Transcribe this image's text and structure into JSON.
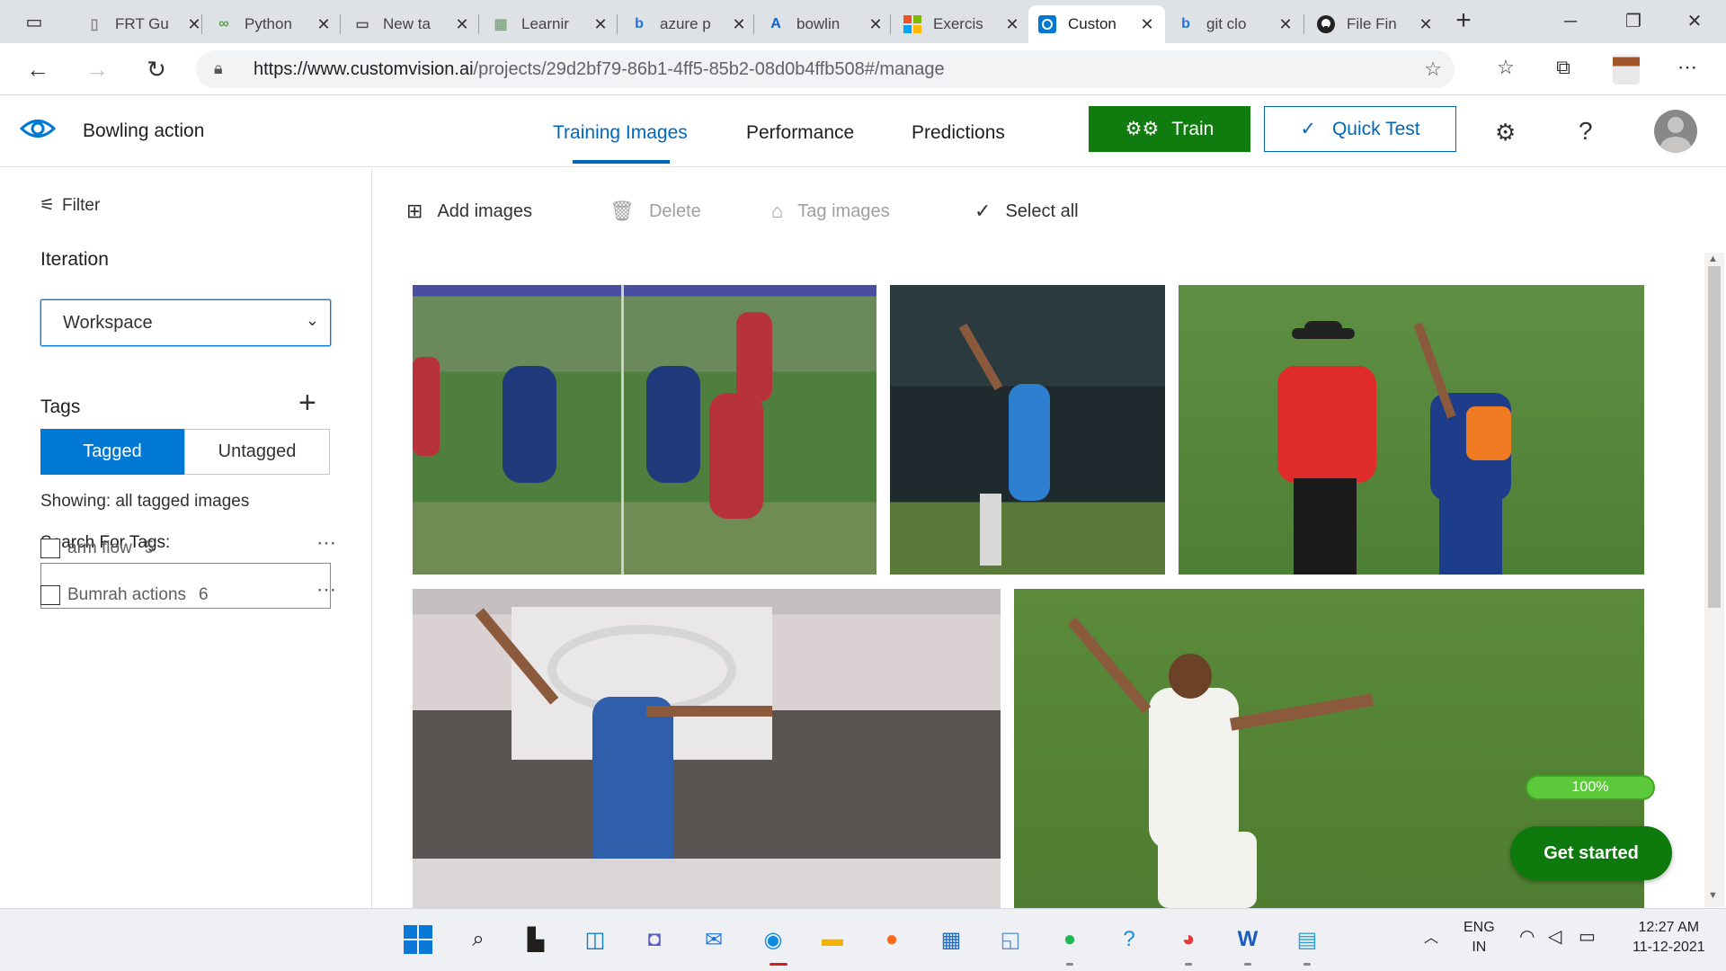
{
  "browser": {
    "tabs": [
      {
        "title": "FRT Gu",
        "icon": "document-icon"
      },
      {
        "title": "Python",
        "icon": "python-icon"
      },
      {
        "title": "New ta",
        "icon": "newtab-icon"
      },
      {
        "title": "Learnir",
        "icon": "learn-icon"
      },
      {
        "title": "azure p",
        "icon": "bing-icon"
      },
      {
        "title": "bowlin",
        "icon": "azure-icon"
      },
      {
        "title": "Exercis",
        "icon": "microsoft-icon"
      },
      {
        "title": "Custon",
        "icon": "customvision-icon",
        "active": true
      },
      {
        "title": "git clo",
        "icon": "bing-icon"
      },
      {
        "title": "File Fin",
        "icon": "github-icon"
      }
    ],
    "url_host": "https://www.customvision.ai",
    "url_path": "/projects/29d2bf79-86b1-4ff5-85b2-08d0b4ffb508#/manage"
  },
  "app": {
    "project_name": "Bowling action",
    "nav": {
      "training": "Training Images",
      "performance": "Performance",
      "predictions": "Predictions"
    },
    "train_label": "Train",
    "quick_test_label": "Quick Test",
    "help_label": "?"
  },
  "sidebar": {
    "filter_label": "Filter",
    "iteration_title": "Iteration",
    "iteration_value": "Workspace",
    "tags_title": "Tags",
    "tagged_label": "Tagged",
    "untagged_label": "Untagged",
    "showing_text": "Showing: all tagged images",
    "search_label": "Search For Tags:",
    "search_value": "",
    "tags": [
      {
        "name": "arm flow",
        "count": "5"
      },
      {
        "name": "Bumrah actions",
        "count": "6"
      }
    ]
  },
  "toolbar": {
    "add_images": "Add images",
    "delete": "Delete",
    "tag_images": "Tag images",
    "select_all": "Select all"
  },
  "progress_text": "100%",
  "progress_fraction": 1.0,
  "get_started": "Get started",
  "taskbar": {
    "lang_line1": "ENG",
    "lang_line2": "IN",
    "time": "12:27 AM",
    "date": "11-12-2021"
  },
  "colors": {
    "accent": "#0078d4",
    "train": "#107c10",
    "get_started": "#0e7a0d"
  }
}
